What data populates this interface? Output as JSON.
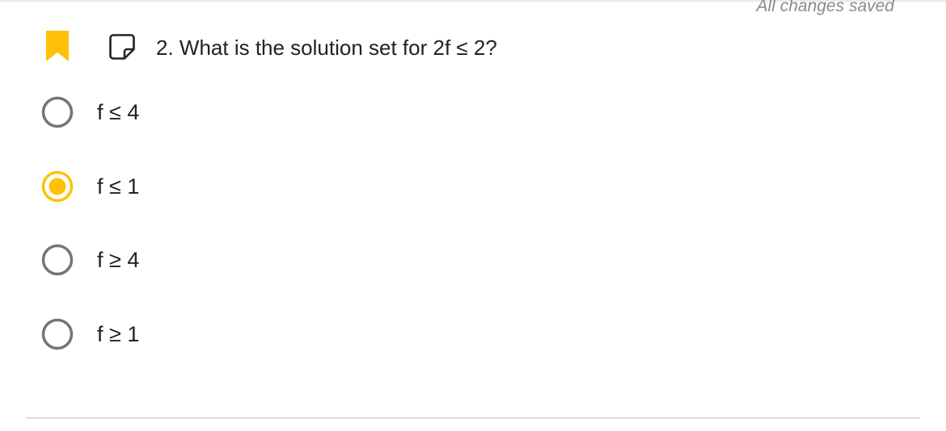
{
  "status": {
    "save_text": "All changes saved"
  },
  "question": {
    "text": "2. What is the solution set for 2f ≤ 2?",
    "bookmark_icon": "bookmark-icon",
    "note_icon": "note-icon",
    "options": [
      {
        "label": "f ≤ 4",
        "selected": false
      },
      {
        "label": "f ≤ 1",
        "selected": true
      },
      {
        "label": "f ≥ 4",
        "selected": false
      },
      {
        "label": "f ≥ 1",
        "selected": false
      }
    ]
  },
  "colors": {
    "accent": "#FFC107",
    "radio_unselected": "#757575",
    "text": "#222222",
    "muted_text": "#8a8a8a",
    "divider": "#dddddd"
  }
}
